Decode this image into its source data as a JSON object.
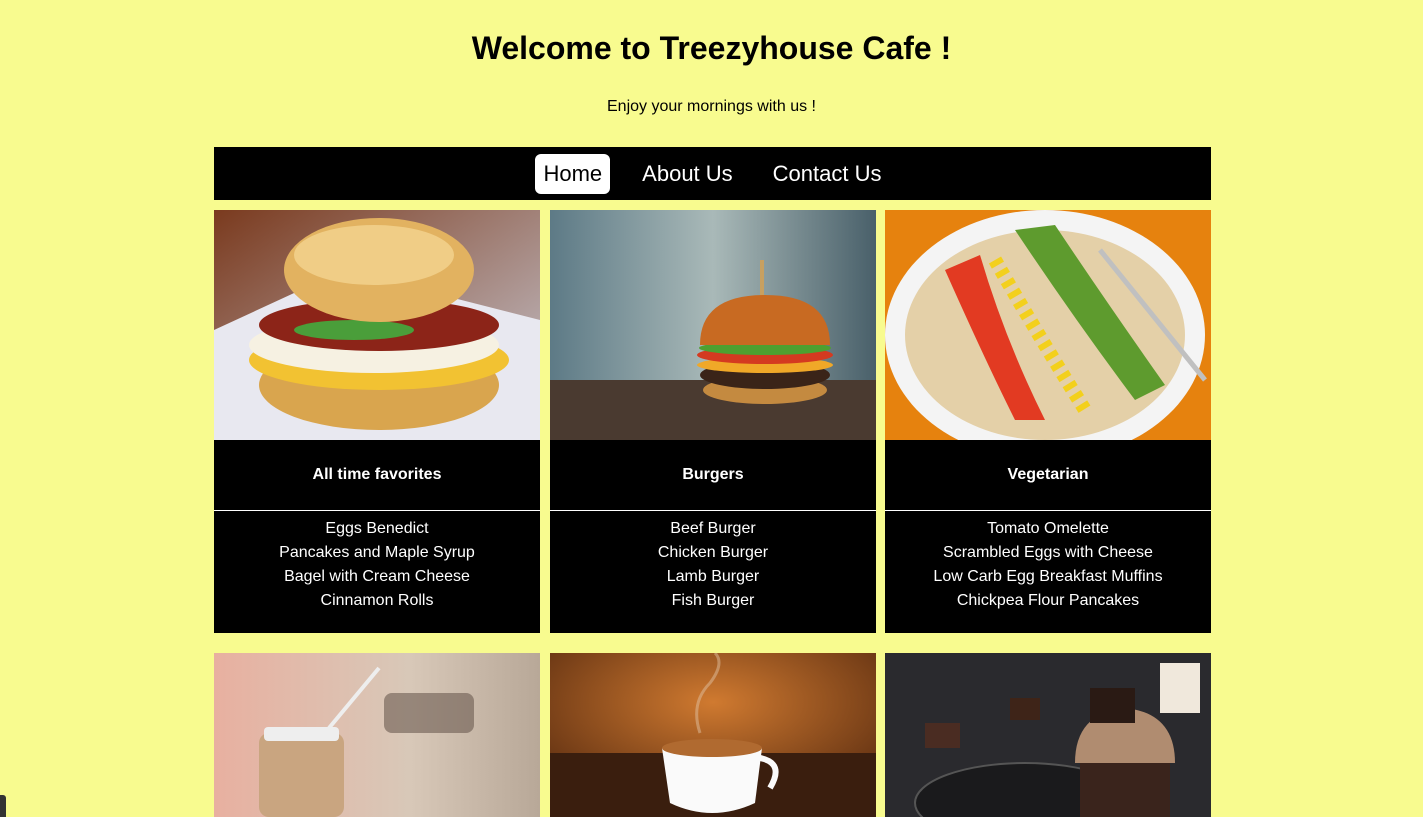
{
  "header": {
    "title": "Welcome to Treezyhouse Cafe !",
    "subtitle": "Enjoy your mornings with us !"
  },
  "nav": {
    "items": [
      {
        "label": "Home",
        "active": true
      },
      {
        "label": "About Us",
        "active": false
      },
      {
        "label": "Contact Us",
        "active": false
      }
    ]
  },
  "cards": [
    {
      "image": "breakfast-sandwich-photo",
      "title": "All time favorites",
      "items": [
        "Eggs Benedict",
        "Pancakes and Maple Syrup",
        "Bagel with Cream Cheese",
        "Cinnamon Rolls"
      ]
    },
    {
      "image": "burger-photo",
      "title": "Burgers",
      "items": [
        "Beef Burger",
        "Chicken Burger",
        "Lamb Burger",
        "Fish Burger"
      ]
    },
    {
      "image": "vegetarian-plate-photo",
      "title": "Vegetarian",
      "items": [
        "Tomato Omelette",
        "Scrambled Eggs with Cheese",
        "Low Carb Egg Breakfast Muffins",
        "Chickpea Flour Pancakes"
      ]
    }
  ],
  "row2_images": [
    "iced-coffee-photo",
    "hot-coffee-photo",
    "chocolate-cupcake-photo"
  ],
  "colors": {
    "background": "#f8fb8f",
    "nav": "#000000",
    "card": "#000000",
    "text_light": "#ffffff"
  }
}
